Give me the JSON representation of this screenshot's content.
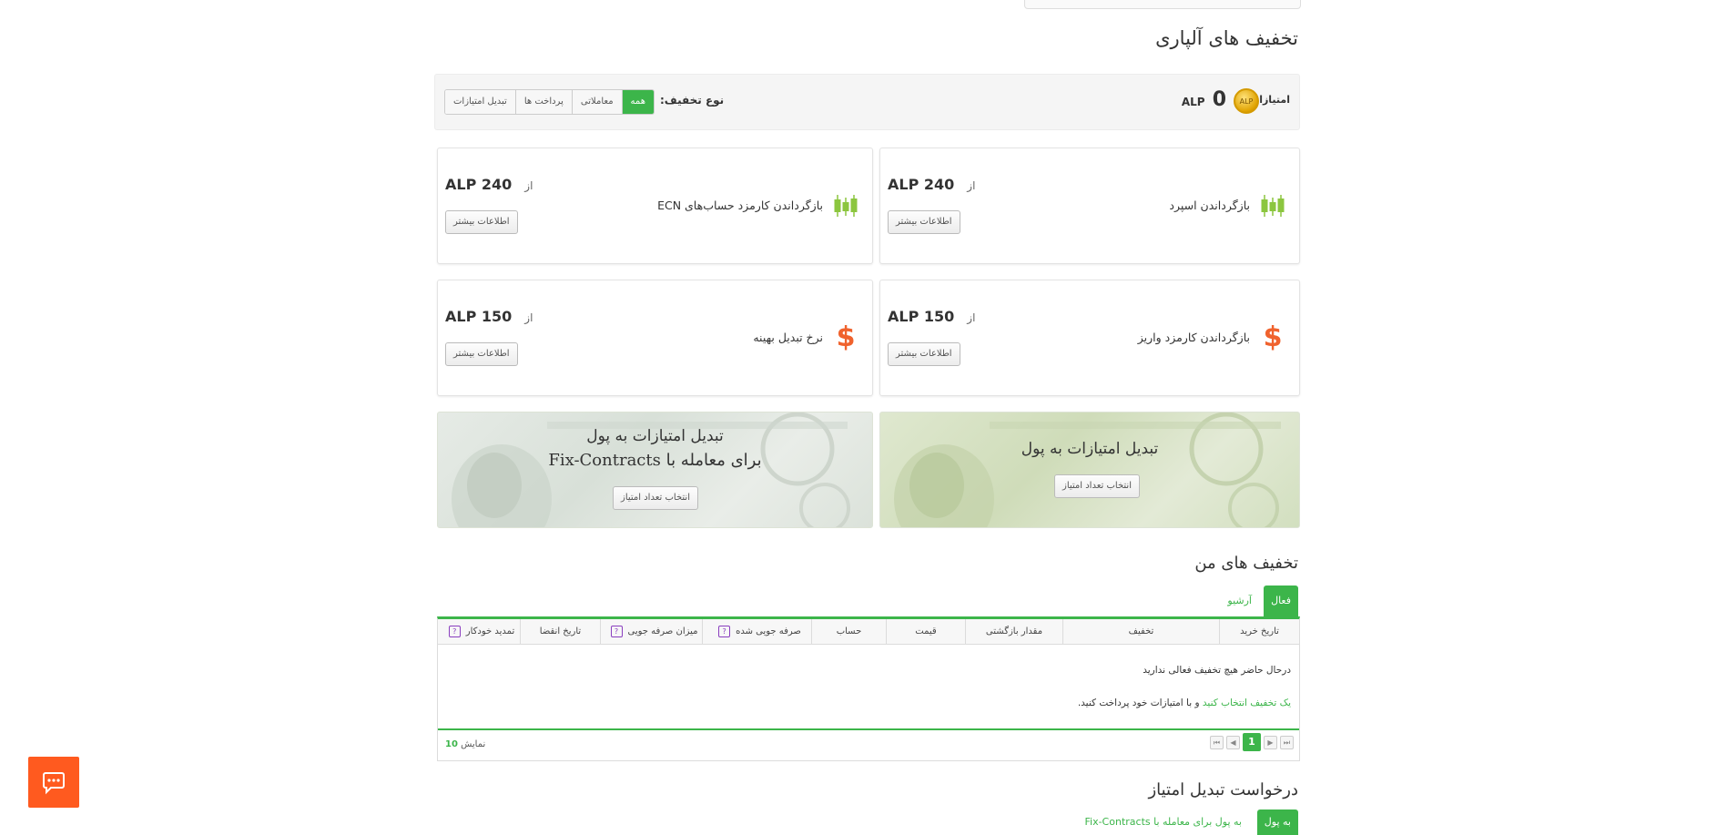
{
  "page": {
    "section_title": "تخفیف های آلپاری",
    "my_discounts_title": "تخفیف های من",
    "exchange_request_title": "درخواست تبدیل امتیاز"
  },
  "points": {
    "label": "امتیازات",
    "value": "0",
    "unit": "ALP",
    "coin_text": "ALP"
  },
  "filter": {
    "label": "نوع تخفیف:",
    "options": [
      "همه",
      "معاملاتی",
      "پرداخت ها",
      "تبدیل امتیازات"
    ],
    "selected": "همه"
  },
  "cards": [
    {
      "title": "بازگرداندن اسپرد",
      "from": "از",
      "price": "ALP 240",
      "more": "اطلاعات بیشتر",
      "icon": "candlestick-chart-icon"
    },
    {
      "title": "بازگرداندن کارمزد حساب‌های ECN",
      "from": "از",
      "price": "ALP 240",
      "more": "اطلاعات بیشتر",
      "icon": "candlestick-chart-icon"
    },
    {
      "title": "بازگرداندن کارمزد واریز",
      "from": "از",
      "price": "ALP 150",
      "more": "اطلاعات بیشتر",
      "icon": "dollar-icon"
    },
    {
      "title": "نرخ تبدیل بهینه",
      "from": "از",
      "price": "ALP 150",
      "more": "اطلاعات بیشتر",
      "icon": "dollar-icon"
    }
  ],
  "banners": [
    {
      "line1": "تبدیل امتیازات به پول",
      "button": "انتخاب تعداد امتیاز"
    },
    {
      "line1": "تبدیل امتیازات به پول",
      "line2": "برای معامله با Fix-Contracts",
      "button": "انتخاب تعداد امتیاز"
    }
  ],
  "tabs": {
    "active": "فعال",
    "archive": "آرشیو"
  },
  "table": {
    "columns": [
      "تاریخ خرید",
      "تخفیف",
      "مقدار بازگشتی",
      "قیمت",
      "حساب",
      "صرفه جویی شده",
      "میزان صرفه جویی",
      "تاریخ انقضا",
      "تمدید خودکار"
    ],
    "help_columns": [
      5,
      6,
      8
    ],
    "help_glyph": "?",
    "empty_message": "درحال حاضر هیچ تخفیف فعالی ندارید",
    "hint_link": "یک تخفیف انتخاب کنید",
    "hint_rest": " و با امتیازات خود پرداخت کنید."
  },
  "pagination": {
    "current_page": "1",
    "first": "⏮",
    "prev": "◀",
    "next": "▶",
    "last": "⏭",
    "show_label": "نمایش",
    "show_count": "10"
  },
  "exchange_tabs": {
    "active": "به پول",
    "other": "به پول برای معامله با Fix-Contracts"
  },
  "colors": {
    "accent": "#3cb54a",
    "dollar": "#f0622d",
    "chat": "#ff5a1f",
    "help": "#8a3fbf"
  }
}
